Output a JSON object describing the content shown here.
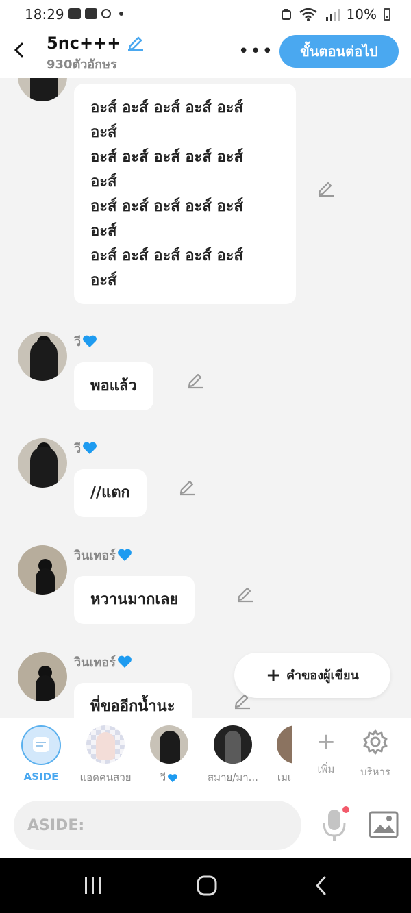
{
  "status": {
    "time": "18:29",
    "battery": "10%"
  },
  "header": {
    "title": "5nc+++",
    "subtitle": "930ตัวอักษร",
    "more": "•••",
    "next_label": "ขั้นตอนต่อไป"
  },
  "messages": [
    {
      "lines": [
        "อะส์ อะส์ อะส์ อะส์ อะส์",
        "อะส์",
        "อะส์ อะส์ อะส์ อะส์ อะส์",
        "อะส์",
        "อะส์ อะส์ อะส์ อะส์ อะส์",
        "อะส์",
        "อะส์ อะส์ อะส์ อะส์ อะส์",
        "อะส์"
      ]
    },
    {
      "name": "วี",
      "text": "พอแล้ว"
    },
    {
      "name": "วี",
      "text": "//แตก"
    },
    {
      "name": "วินเทอร์",
      "text": "หวานมากเลย"
    },
    {
      "name": "วินเทอร์",
      "text": "พี่ขออีกน้ำนะ"
    }
  ],
  "fab": {
    "label": "คำของผู้เขียน"
  },
  "characters": [
    {
      "label": "ASIDE"
    },
    {
      "label": "แอดคนสวย"
    },
    {
      "label": "วี"
    },
    {
      "label": "สมาย/มา..."
    },
    {
      "label": "เมเ"
    }
  ],
  "tools": {
    "add_label": "เพิ่ม",
    "manage_label": "บริหาร"
  },
  "input": {
    "placeholder": "ASIDE:"
  },
  "colors": {
    "accent": "#4aa8f0",
    "heart": "#1e9bf0",
    "mic_dot": "#f25a6b"
  }
}
